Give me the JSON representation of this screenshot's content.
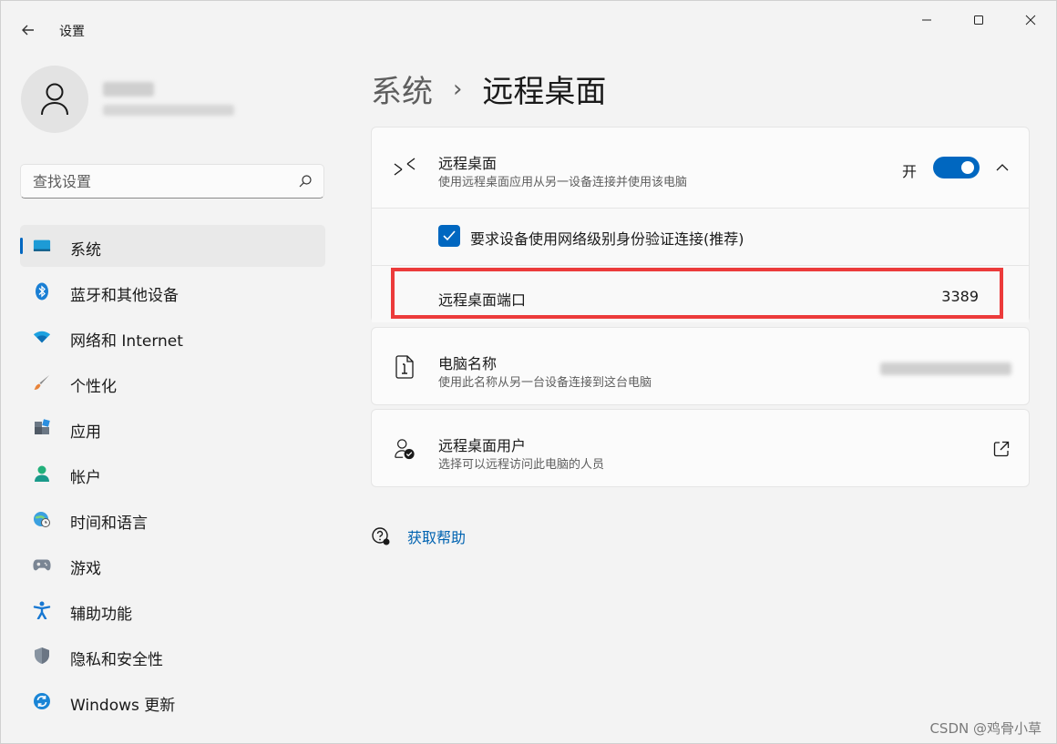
{
  "app": {
    "title": "设置"
  },
  "nav": {
    "search_placeholder": "查找设置",
    "items": [
      {
        "label": "系统",
        "icon": "monitor-icon",
        "selected": true
      },
      {
        "label": "蓝牙和其他设备",
        "icon": "bluetooth-icon"
      },
      {
        "label": "网络和 Internet",
        "icon": "wifi-icon"
      },
      {
        "label": "个性化",
        "icon": "brush-icon"
      },
      {
        "label": "应用",
        "icon": "apps-icon"
      },
      {
        "label": "帐户",
        "icon": "account-icon"
      },
      {
        "label": "时间和语言",
        "icon": "globe-clock-icon"
      },
      {
        "label": "游戏",
        "icon": "gamepad-icon"
      },
      {
        "label": "辅助功能",
        "icon": "accessibility-icon"
      },
      {
        "label": "隐私和安全性",
        "icon": "shield-icon"
      },
      {
        "label": "Windows 更新",
        "icon": "update-icon"
      }
    ]
  },
  "breadcrumb": {
    "parent": "系统",
    "separator": "›",
    "current": "远程桌面"
  },
  "remote_desktop": {
    "title": "远程桌面",
    "subtitle": "使用远程桌面应用从另一设备连接并使用该电脑",
    "toggle_label": "开",
    "toggle_on": true,
    "nla_label": "要求设备使用网络级别身份验证连接(推荐)",
    "nla_checked": true,
    "port_label": "远程桌面端口",
    "port_value": "3389"
  },
  "pc_name": {
    "title": "电脑名称",
    "subtitle": "使用此名称从另一台设备连接到这台电脑"
  },
  "remote_users": {
    "title": "远程桌面用户",
    "subtitle": "选择可以远程访问此电脑的人员"
  },
  "help": {
    "label": "获取帮助"
  },
  "watermark": "CSDN @鸡骨小草",
  "colors": {
    "accent": "#0067c0",
    "highlight": "#ec3b3b",
    "link": "#0063b1"
  }
}
